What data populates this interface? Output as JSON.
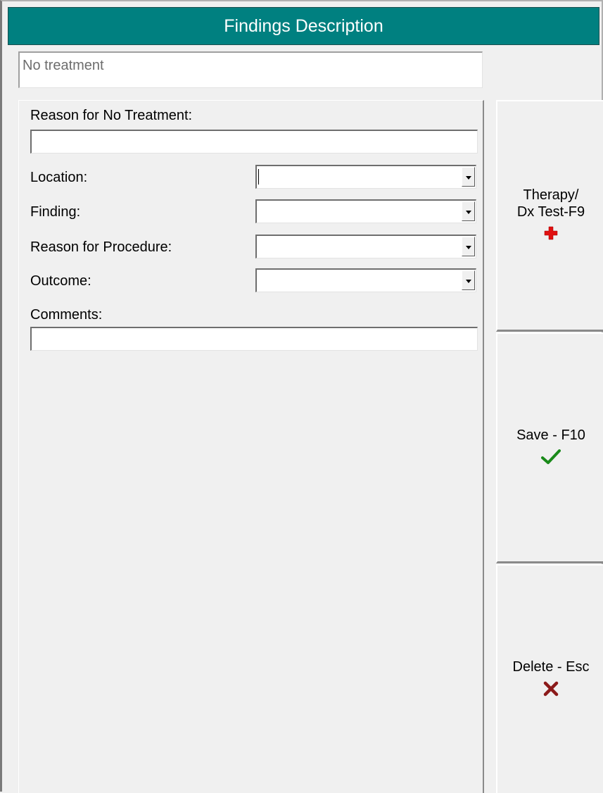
{
  "window": {
    "title": "Findings Description"
  },
  "summary": {
    "value": "No treatment"
  },
  "form": {
    "reason_no_treatment_label": "Reason for No Treatment:",
    "reason_no_treatment_value": "",
    "location_label": "Location:",
    "location_value": "",
    "finding_label": "Finding:",
    "finding_value": "",
    "reason_procedure_label": "Reason for Procedure:",
    "reason_procedure_value": "",
    "outcome_label": "Outcome:",
    "outcome_value": "",
    "comments_label": "Comments:",
    "comments_value": ""
  },
  "buttons": {
    "therapy_label": "Therapy/\nDx Test-F9",
    "therapy_icon": "red-cross-icon",
    "save_label": "Save - F10",
    "save_icon": "green-checkmark-icon",
    "delete_label": "Delete - Esc",
    "delete_icon": "dark-red-x-icon"
  },
  "colors": {
    "title_bar": "#008080",
    "therapy_icon": "#e01010",
    "save_icon": "#1a8a1a",
    "delete_icon": "#8b1a1a"
  }
}
